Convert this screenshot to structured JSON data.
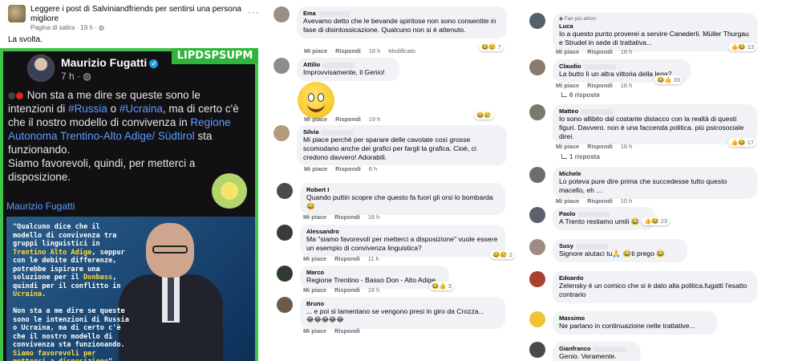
{
  "post": {
    "group_title": "Leggere i post di Salviniandfriends per sentirsi una persona migliore",
    "meta": "Pagina di satira · 19 h · ",
    "more": "···",
    "caption": "La svolta.",
    "tweet": {
      "name": "Maurizio Fugatti",
      "verified": "✓",
      "time": "7 h · ",
      "badge": "LIPDSPSUPM",
      "text_a": " Non sta a me dire se queste sono le intenzioni di ",
      "tag_russia": "#Russia",
      "text_b": " o ",
      "tag_ucraina": "#Ucraina",
      "text_c": ", ma di certo c'è che il nostro modello di convivenza in ",
      "region": "Regione Autonoma Trentino-Alto Adige/ Südtirol",
      "text_d": " sta funzionando.",
      "text_e": "Siamo favorevoli, quindi, per metterci a disposizione.",
      "author_footer": "Maurizio Fugatti"
    },
    "quote": {
      "p1_a": "\"Qualcuno dice che il\nmodello di convivenza tra\ngruppi linguistici in\n",
      "p1_y1": "Trentino Alto Adige",
      "p1_b": ", seppur\ncon le debite differenze,\npotrebbe ispirare una\nsoluzione per il ",
      "p1_y2": "Donbass",
      "p1_c": ",\nquindi per il conflitto in\n",
      "p1_y3": "Ucraina",
      "p1_d": ".\n\nNon sta a me dire se queste\nsono le intenzioni di Russia\no Ucraina, ma di certo c'è\nche il nostro modello di\nconvivenza sta funzionando.\n",
      "p1_y4": "Siamo favorevoli per\nmetterci a disposizione",
      "p1_e": "\""
    }
  },
  "actions": {
    "like": "Mi piace",
    "reply": "Rispondi",
    "modified": "Modificato"
  },
  "middle_comments": [
    {
      "author": "Ema",
      "text": "Avevamo detto che le bevande spiritose non sono consentite in fase di disintossicazione. Qualcuno non si è attenuto.",
      "time": "18 h",
      "reactions": "😂😢 7",
      "avatar_color": "#9a8f86"
    },
    {
      "author": "Attilio",
      "text": "Improvvisamente, il Genio!",
      "time": "19 h",
      "reactions": "😂😢",
      "avatar_color": "#8c8c8c"
    },
    {
      "author": "Silvia",
      "text": "Mi piace perchè per sparare delle cavolate così grosse scomodano anche dei grafici per fargli la grafica. Cioè, ci credono davvero! Adorabili.",
      "time": "6 h",
      "reactions": "",
      "avatar_color": "#b59a7c"
    },
    {
      "author": "Robert I",
      "text": "Quando puttin scopre che questo fa fuori gli orsi lo bombarda😂",
      "time": "18 h",
      "reactions": "",
      "avatar_color": "#4b4b4b"
    },
    {
      "author": "Alessandro",
      "text": "Ma \"siamo favorevoli per metterci a disposizione\" vuole essere un esempio di convivenza linguistica?",
      "time": "11 h",
      "reactions": "😂😢 2",
      "avatar_color": "#3a3a3a"
    },
    {
      "author": "Marco",
      "text": "Regione Trentino - Basso Don - Alto Adige",
      "time": "18 h",
      "reactions": "😂👍 3",
      "avatar_color": "#2f3b2f"
    },
    {
      "author": "Bruno",
      "text": "... e poi si lamentano se vengono presi in giro da Crozza...",
      "text2": "😂😂😂😂😂",
      "time": "",
      "reactions": "",
      "avatar_color": "#6b5a4a"
    }
  ],
  "right_comments": [
    {
      "author": "Luca",
      "fan": "Fan più attivo",
      "text": "Io a questo punto proverei a servire Canederli. Müller Thurgau e Strudel in sede di trattativa...",
      "time": "18 h",
      "reactions": "👍😂 13",
      "avatar_color": "#55606b"
    },
    {
      "author": "Claudio",
      "text": "La butto lì un altra vittoria della lega?",
      "time": "18 h",
      "reactions": "😂👍 33",
      "replies": "6 risposte",
      "avatar_color": "#8a7b6e"
    },
    {
      "author": "Matteo",
      "text": "Io sono allibito dal costante distacco con la realtà di questi figuri. Davvero. non è una faccenda politica. più psicosociale direi.",
      "time": "16 h",
      "reactions": "👍😂 17",
      "replies": "1 risposta",
      "avatar_color": "#7c7770"
    },
    {
      "author": "Michele",
      "text": "Lo poteva pure dire prima che succedesse tutto questo macello, eh ...",
      "time": "10 h",
      "reactions": "",
      "avatar_color": "#6d6d6d"
    },
    {
      "author": "Paolo",
      "text": "A Trento restiamo umili 😂",
      "time": "",
      "reactions": "👍😂 23",
      "avatar_color": "#5a6270"
    },
    {
      "author": "Susy",
      "text": "Signore aiutaci tu🙏 😂ti prego 😂",
      "time": "",
      "reactions": "",
      "avatar_color": "#9d8a82"
    },
    {
      "author": "Edoardo",
      "text": "Zelensky è un comico che si è dato alla politica.fugatti l'esatto contrario",
      "time": "",
      "reactions": "",
      "avatar_color": "#a9412f"
    },
    {
      "author": "Massimo",
      "text": "Ne parlano in continuazione nelle trattative...",
      "time": "",
      "reactions": "",
      "avatar_color": "#f1c232"
    },
    {
      "author": "Gianfranco",
      "text": "Genio. Veramente.",
      "time": "",
      "reactions": "",
      "avatar_color": "#4a4a4a"
    }
  ]
}
